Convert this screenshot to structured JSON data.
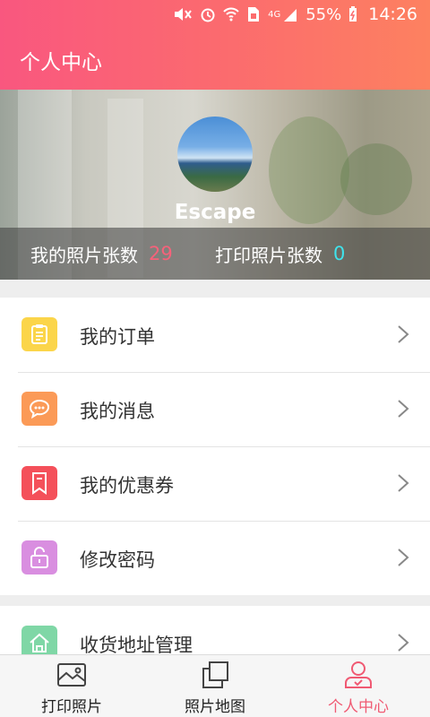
{
  "status_bar": {
    "battery": "55%",
    "time": "14:26",
    "network": "4G"
  },
  "header": {
    "title": "个人中心"
  },
  "profile": {
    "username": "Escape",
    "my_photos_label": "我的照片张数",
    "my_photos_count": "29",
    "printed_photos_label": "打印照片张数",
    "printed_photos_count": "0"
  },
  "menu": {
    "items": [
      {
        "label": "我的订单",
        "icon": "clipboard-icon",
        "color": "#fbd54a"
      },
      {
        "label": "我的消息",
        "icon": "chat-bubble-icon",
        "color": "#fb9a57"
      },
      {
        "label": "我的优惠券",
        "icon": "bookmark-icon",
        "color": "#f4505a"
      },
      {
        "label": "修改密码",
        "icon": "lock-icon",
        "color": "#d98ee0"
      },
      {
        "label": "收货地址管理",
        "icon": "home-icon",
        "color": "#7fd7a6"
      }
    ]
  },
  "bottom_nav": {
    "tabs": [
      {
        "label": "打印照片",
        "icon": "photo-icon",
        "active": false
      },
      {
        "label": "照片地图",
        "icon": "stack-icon",
        "active": false
      },
      {
        "label": "个人中心",
        "icon": "user-icon",
        "active": true
      }
    ],
    "active_color": "#f05a73"
  }
}
